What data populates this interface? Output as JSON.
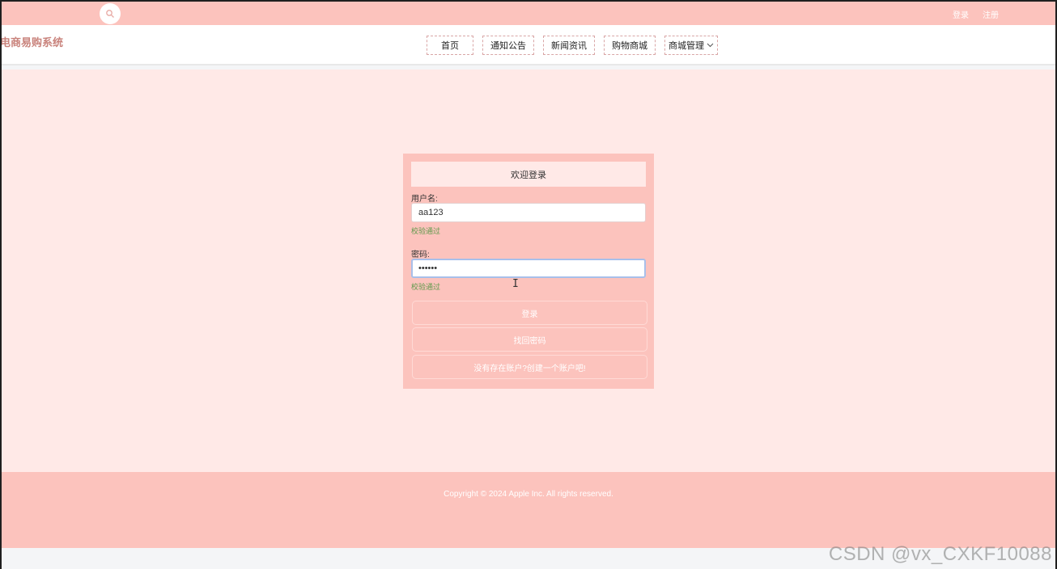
{
  "topbar": {
    "search_icon": "search-icon",
    "login_link": "登录",
    "register_link": "注册"
  },
  "navbar": {
    "brand": "电商易购系统",
    "items": [
      {
        "label": "首页"
      },
      {
        "label": "通知公告"
      },
      {
        "label": "新闻资讯"
      },
      {
        "label": "购物商城"
      },
      {
        "label": "商城管理",
        "has_dropdown": true
      }
    ]
  },
  "login_form": {
    "title": "欢迎登录",
    "username_label": "用户名:",
    "username_value": "aa123",
    "username_valid": "校验通过",
    "password_label": "密码:",
    "password_value": "••••••",
    "password_valid": "校验通过",
    "login_button": "登录",
    "forgot_button": "找回密码",
    "register_button": "没有存在账户?创建一个账户吧!"
  },
  "footer": {
    "copyright": "Copyright © 2024 Apple Inc. All rights reserved."
  },
  "watermark": "CSDN @vx_CXKF10088",
  "colors": {
    "accent": "#fcc3bd",
    "background": "#ffe9e7",
    "valid": "#5f9a4c",
    "brand": "#c9837c"
  }
}
